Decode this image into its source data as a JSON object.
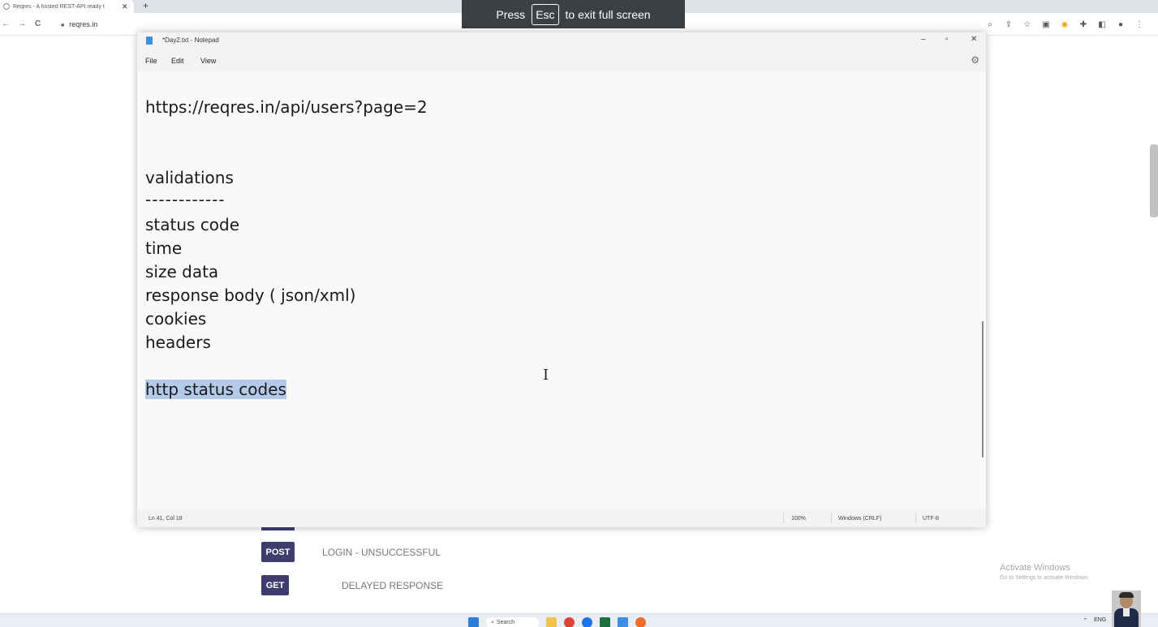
{
  "browser": {
    "tab_title": "Reqres - A hosted REST-API ready t",
    "tab_close": "✕",
    "new_tab": "+",
    "back": "←",
    "forward": "→",
    "reload": "C",
    "url": "reqres.in"
  },
  "fullscreen_notice": {
    "press": "Press",
    "key": "Esc",
    "rest": "to exit full screen"
  },
  "background_page": {
    "rows": [
      {
        "method": "POST",
        "label": "LOGIN - UNSUCCESSFUL"
      },
      {
        "method": "GET",
        "label": "DELAYED RESPONSE"
      }
    ],
    "activate_title": "Activate Windows",
    "activate_sub": "Go to Settings to activate Windows."
  },
  "notepad": {
    "title": "*Day2.txt - Notepad",
    "menu": [
      "File",
      "Edit",
      "View"
    ],
    "lines": {
      "url": "https://reqres.in/api/users?page=2",
      "validations": "validations",
      "dashes": "------------",
      "status_code": "status code",
      "time": "time",
      "size_data": "size data",
      "response_body": "response body ( json/xml)",
      "cookies": "cookies",
      "headers": "headers",
      "selected": "http status codes"
    },
    "status": {
      "position": "Ln 41, Col 18",
      "zoom": "100%",
      "line_ending": "Windows (CRLF)",
      "encoding": "UTF-8"
    }
  },
  "taskbar": {
    "search": "Search",
    "lang": "ENG"
  },
  "colors": {
    "method_badge": "#3f3d6e",
    "selection": "#b3cbe9",
    "notice_bg": "#3c4043"
  }
}
